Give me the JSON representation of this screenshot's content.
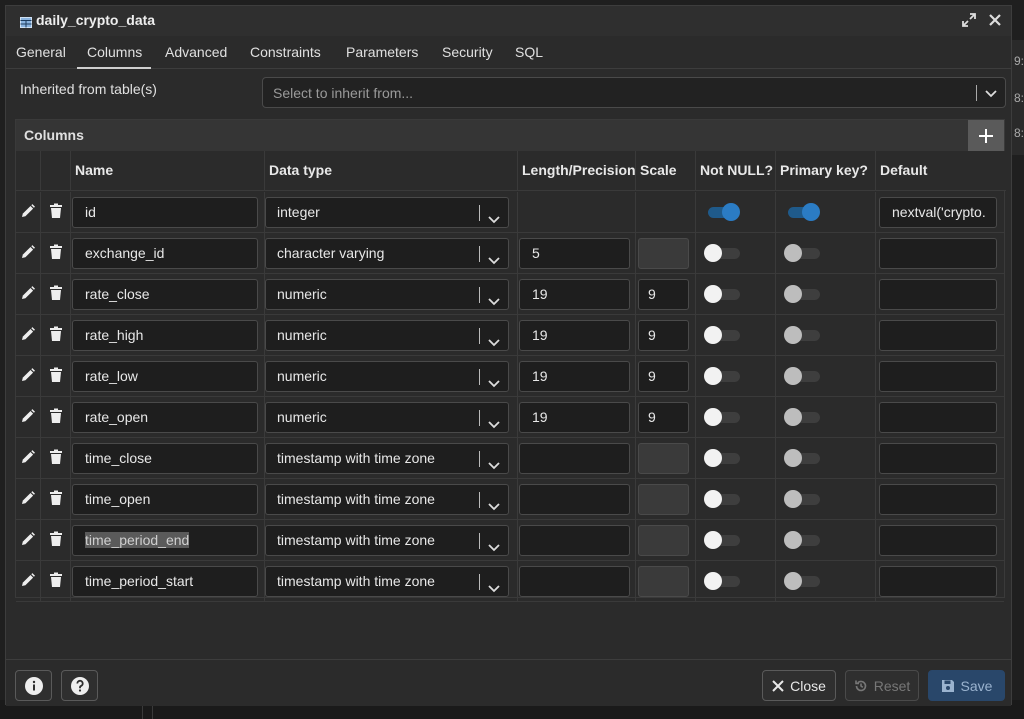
{
  "dialog": {
    "title": "daily_crypto_data",
    "tabs": [
      "General",
      "Columns",
      "Advanced",
      "Constraints",
      "Parameters",
      "Security",
      "SQL"
    ],
    "active_tab": "Columns"
  },
  "inherit": {
    "label": "Inherited from table(s)",
    "placeholder": "Select to inherit from..."
  },
  "columns_panel": {
    "title": "Columns",
    "headers": [
      "Name",
      "Data type",
      "Length/Precision",
      "Scale",
      "Not NULL?",
      "Primary key?",
      "Default"
    ]
  },
  "rows": [
    {
      "name": "id",
      "type": "integer",
      "length": "",
      "scale": "",
      "not_null": true,
      "pk": true,
      "default": "nextval('crypto."
    },
    {
      "name": "exchange_id",
      "type": "character varying",
      "length": "5",
      "scale": "",
      "not_null": false,
      "pk": false,
      "default": ""
    },
    {
      "name": "rate_close",
      "type": "numeric",
      "length": "19",
      "scale": "9",
      "not_null": false,
      "pk": false,
      "default": ""
    },
    {
      "name": "rate_high",
      "type": "numeric",
      "length": "19",
      "scale": "9",
      "not_null": false,
      "pk": false,
      "default": ""
    },
    {
      "name": "rate_low",
      "type": "numeric",
      "length": "19",
      "scale": "9",
      "not_null": false,
      "pk": false,
      "default": ""
    },
    {
      "name": "rate_open",
      "type": "numeric",
      "length": "19",
      "scale": "9",
      "not_null": false,
      "pk": false,
      "default": ""
    },
    {
      "name": "time_close",
      "type": "timestamp with time zone",
      "length": "",
      "scale": "",
      "not_null": false,
      "pk": false,
      "default": ""
    },
    {
      "name": "time_open",
      "type": "timestamp with time zone",
      "length": "",
      "scale": "",
      "not_null": false,
      "pk": false,
      "default": ""
    },
    {
      "name": "time_period_end",
      "type": "timestamp with time zone",
      "length": "",
      "scale": "",
      "not_null": false,
      "pk": false,
      "default": ""
    },
    {
      "name": "time_period_start",
      "type": "timestamp with time zone",
      "length": "",
      "scale": "",
      "not_null": false,
      "pk": false,
      "default": ""
    }
  ],
  "footer": {
    "close_label": "Close",
    "reset_label": "Reset",
    "save_label": "Save"
  },
  "background": {
    "edge_text": [
      "9:",
      "8:",
      "8:"
    ]
  },
  "colors": {
    "accent": "#2b7cc4",
    "save_bg": "#29476a"
  }
}
